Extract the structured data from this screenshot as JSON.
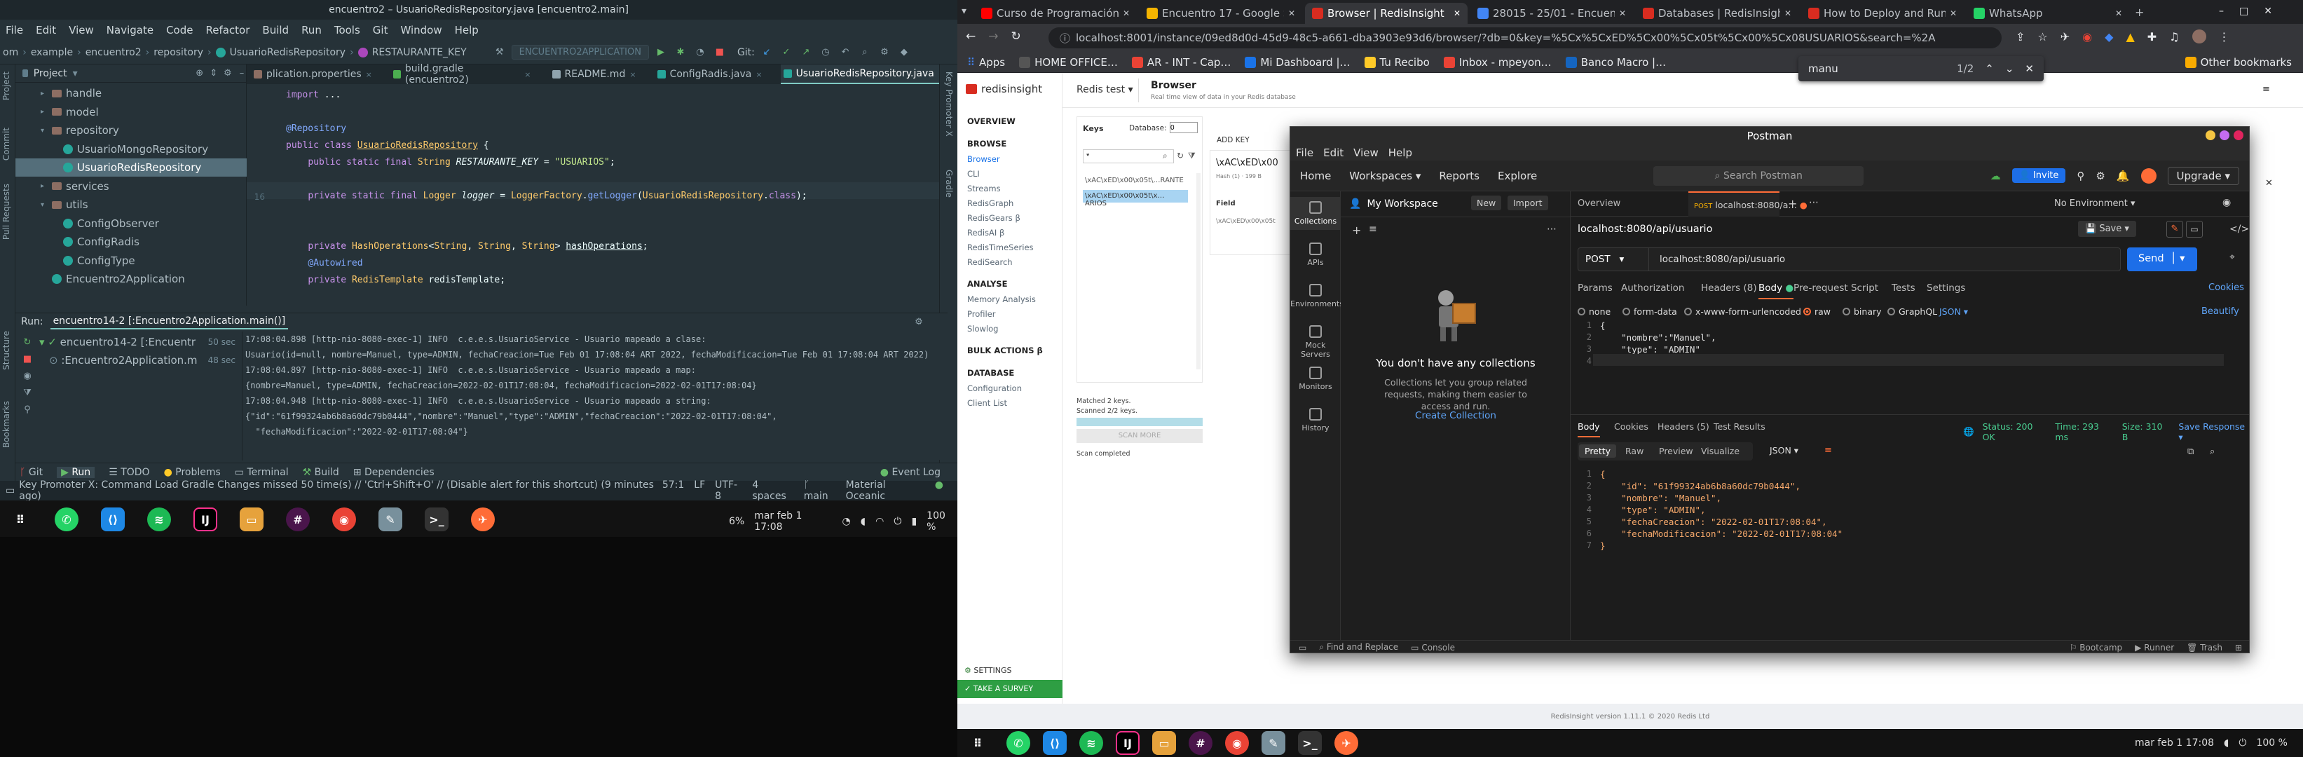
{
  "ide": {
    "title": "encuentro2 – UsuarioRedisRepository.java [encuentro2.main]",
    "menu": [
      "File",
      "Edit",
      "View",
      "Navigate",
      "Code",
      "Refactor",
      "Build",
      "Run",
      "Tools",
      "Git",
      "Window",
      "Help"
    ],
    "breadcrumb": [
      "om",
      "example",
      "encuentro2",
      "repository",
      "UsuarioRedisRepository",
      "RESTAURANTE_KEY"
    ],
    "run_config": "ENCUENTRO2APPLICATION",
    "git_label": "Git:",
    "project_label": "Project",
    "tree": [
      {
        "label": "handle",
        "type": "folder",
        "indent": 1,
        "arrow": "▸"
      },
      {
        "label": "model",
        "type": "folder",
        "indent": 1,
        "arrow": "▸"
      },
      {
        "label": "repository",
        "type": "folder",
        "indent": 1,
        "arrow": "▾"
      },
      {
        "label": "UsuarioMongoRepository",
        "type": "class",
        "indent": 2,
        "arrow": ""
      },
      {
        "label": "UsuarioRedisRepository",
        "type": "class",
        "indent": 2,
        "arrow": "",
        "selected": true
      },
      {
        "label": "services",
        "type": "folder",
        "indent": 1,
        "arrow": "▸"
      },
      {
        "label": "utils",
        "type": "folder",
        "indent": 1,
        "arrow": "▾"
      },
      {
        "label": "ConfigObserver",
        "type": "class",
        "indent": 2,
        "arrow": ""
      },
      {
        "label": "ConfigRadis",
        "type": "class",
        "indent": 2,
        "arrow": ""
      },
      {
        "label": "ConfigType",
        "type": "class",
        "indent": 2,
        "arrow": ""
      },
      {
        "label": "Encuentro2Application",
        "type": "class",
        "indent": 1,
        "arrow": ""
      }
    ],
    "tabs": [
      {
        "label": "plication.properties",
        "color": "#8d6e63"
      },
      {
        "label": "build.gradle (encuentro2)",
        "color": "#4caf50"
      },
      {
        "label": "README.md",
        "color": "#90a4ae"
      },
      {
        "label": "ConfigRadis.java",
        "color": "#26a69a"
      },
      {
        "label": "UsuarioRedisRepository.java",
        "color": "#26a69a",
        "active": true
      }
    ],
    "line_numbers": [
      "",
      "",
      "",
      "",
      "",
      "",
      "16",
      "",
      "",
      "",
      "",
      "",
      "",
      ""
    ],
    "run_label": "Run:",
    "run_tab": "encuentro14-2 [:Encuentro2Application.main()]",
    "run_tree": [
      {
        "label": "encuentro14-2 [:Encuentr",
        "time": "50 sec"
      },
      {
        "label": ":Encuentro2Application.m",
        "time": "48 sec"
      }
    ],
    "console_lines": [
      "17:08:04.898 [http-nio-8080-exec-1] INFO  c.e.e.s.UsuarioService - Usuario mapeado a clase:",
      "Usuario(id=null, nombre=Manuel, type=ADMIN, fechaCreacion=Tue Feb 01 17:08:04 ART 2022, fechaModificacion=Tue Feb 01 17:08:04 ART 2022)",
      "17:08:04.897 [http-nio-8080-exec-1] INFO  c.e.e.s.UsuarioService - Usuario mapeado a map:",
      "{nombre=Manuel, type=ADMIN, fechaCreacion=2022-02-01T17:08:04, fechaModificacion=2022-02-01T17:08:04}",
      "17:08:04.948 [http-nio-8080-exec-1] INFO  c.e.e.s.UsuarioService - Usuario mapeado a string:",
      "{\"id\":\"61f99324ab6b8a60dc79b0444\",\"nombre\":\"Manuel\",\"type\":\"ADMIN\",\"fechaCreacion\":\"2022-02-01T17:08:04\",",
      "  \"fechaModificacion\":\"2022-02-01T17:08:04\"}"
    ],
    "bottom_tabs": [
      "Git",
      "Run",
      "TODO",
      "Problems",
      "Terminal",
      "Build",
      "Dependencies"
    ],
    "event_log": "Event Log",
    "status_msg": "Key Promoter X: Command Load Gradle Changes missed 50 time(s) // 'Ctrl+Shift+O' // (Disable alert for this shortcut) (9 minutes ago)",
    "status_right": [
      "57:1",
      "LF",
      "UTF-8",
      "4 spaces",
      "main",
      "Material Oceanic"
    ],
    "side_tabs_left": [
      "Project",
      "Commit",
      "Pull Requests",
      "Structure",
      "Bookmarks"
    ],
    "side_tabs_right": [
      "Key Promoter X",
      "Gradle"
    ]
  },
  "taskbar_left": {
    "clock": "mar feb 1  17:08",
    "battery": "100 %",
    "misc": "6%"
  },
  "chrome": {
    "tabs": [
      {
        "label": "Curso de Programación B…",
        "color": "#ff0000"
      },
      {
        "label": "Encuentro 17 - Google Sli…",
        "color": "#f4b400"
      },
      {
        "label": "Browser | RedisInsight",
        "color": "#d82c20",
        "active": true
      },
      {
        "label": "28015 - 25/01 - Encuentr…",
        "color": "#4285f4"
      },
      {
        "label": "Databases | RedisInsight",
        "color": "#d82c20"
      },
      {
        "label": "How to Deploy and Run R…",
        "color": "#d82c20"
      },
      {
        "label": "WhatsApp",
        "color": "#25d366"
      }
    ],
    "url": "localhost:8001/instance/09ed8d0d-45d9-48c5-a661-dba3903e93d6/browser/?db=0&key=%5Cx%5CxED%5Cx00%5Cx05t%5Cx00%5Cx08USUARIOS&search=%2A",
    "bookmarks": [
      "Apps",
      "HOME OFFICE…",
      "AR - INT - Cap…",
      "Mi Dashboard |…",
      "Tu Recibo",
      "Inbox - mpeyon…",
      "Banco Macro |…"
    ],
    "other_bookmarks": "Other bookmarks",
    "find": {
      "query": "manu",
      "count": "1/2"
    }
  },
  "redisinsight": {
    "logo": "redisinsight",
    "db_name": "Redis test",
    "page_title": "Browser",
    "page_sub": "Real time view of data in your Redis database",
    "nav": [
      {
        "label": "OVERVIEW",
        "section": true
      },
      {
        "label": "BROWSE",
        "section": true
      },
      {
        "label": "Browser",
        "on": true
      },
      {
        "label": "CLI"
      },
      {
        "label": "Streams"
      },
      {
        "label": "RedisGraph"
      },
      {
        "label": "RedisGears β"
      },
      {
        "label": "RedisAI β"
      },
      {
        "label": "RedisTimeSeries"
      },
      {
        "label": "RediSearch"
      },
      {
        "label": "ANALYSE",
        "section": true
      },
      {
        "label": "Memory Analysis"
      },
      {
        "label": "Profiler"
      },
      {
        "label": "Slowlog"
      },
      {
        "label": "BULK ACTIONS β",
        "section": true
      },
      {
        "label": "DATABASE",
        "section": true
      },
      {
        "label": "Configuration"
      },
      {
        "label": "Client List"
      }
    ],
    "settings": "SETTINGS",
    "survey": "TAKE A SURVEY",
    "keys_label": "Keys",
    "database_label": "Database:",
    "database_value": "0",
    "search_value": "*",
    "keys": [
      "\\xAC\\xED\\x00\\x05t\\…RANTE",
      "\\xAC\\xED\\x00\\x05t\\x…ARIOS"
    ],
    "matched": "Matched 2 keys.",
    "scanned": "Scanned 2/2 keys.",
    "scan_more": "SCAN MORE",
    "scan_done": "Scan completed",
    "add_key": "ADD KEY",
    "key_title": "\\xAC\\xED\\x00",
    "key_meta": "Hash (1) · 199 B",
    "field_label": "Field",
    "field_value": "\\xAC\\xED\\x00\\x05t",
    "footer": "RedisInsight version 1.11.1 © 2020 Redis Ltd"
  },
  "postman": {
    "title": "Postman",
    "menu": [
      "File",
      "Edit",
      "View",
      "Help"
    ],
    "nav": [
      "Home",
      "Workspaces",
      "Reports",
      "Explore"
    ],
    "search": "Search Postman",
    "invite": "Invite",
    "upgrade": "Upgrade",
    "workspace": "My Workspace",
    "new_btn": "New",
    "import_btn": "Import",
    "rail": [
      "Collections",
      "APIs",
      "Environments",
      "Mock Servers",
      "Monitors",
      "History"
    ],
    "empty_title": "You don't have any collections",
    "empty_text": "Collections let you group related requests, making them easier to access and run.",
    "create_collection": "Create Collection",
    "tab_overview": "Overview",
    "tab_method": "POST",
    "tab_url": "localhost:8080/a…",
    "environment": "No Environment",
    "request_name": "localhost:8080/api/usuario",
    "save": "Save",
    "method": "POST",
    "url": "localhost:8080/api/usuario",
    "send": "Send",
    "req_tabs": [
      "Params",
      "Authorization",
      "Headers (8)",
      "Body",
      "Pre-request Script",
      "Tests",
      "Settings"
    ],
    "cookies": "Cookies",
    "body_types": [
      "none",
      "form-data",
      "x-www-form-urlencoded",
      "raw",
      "binary",
      "GraphQL"
    ],
    "body_format": "JSON",
    "beautify": "Beautify",
    "req_body": [
      "{",
      "    \"nombre\":\"Manuel\",",
      "    \"type\": \"ADMIN\"",
      "}"
    ],
    "res_tabs": [
      "Body",
      "Cookies",
      "Headers (5)",
      "Test Results"
    ],
    "status": "Status: 200 OK",
    "time": "Time: 293 ms",
    "size": "Size: 310 B",
    "save_response": "Save Response",
    "view_modes": [
      "Pretty",
      "Raw",
      "Preview",
      "Visualize"
    ],
    "res_format": "JSON",
    "res_body": [
      "{",
      "    \"id\": \"61f99324ab6b8a60dc79b0444\",",
      "    \"nombre\": \"Manuel\",",
      "    \"type\": \"ADMIN\",",
      "    \"fechaCreacion\": \"2022-02-01T17:08:04\",",
      "    \"fechaModificacion\": \"2022-02-01T17:08:04\"",
      "}"
    ],
    "footer": [
      "Find and Replace",
      "Console",
      "Bootcamp",
      "Runner",
      "Trash"
    ]
  },
  "taskbar_right": {
    "clock": "mar feb 1  17:08",
    "battery": "100 %"
  }
}
